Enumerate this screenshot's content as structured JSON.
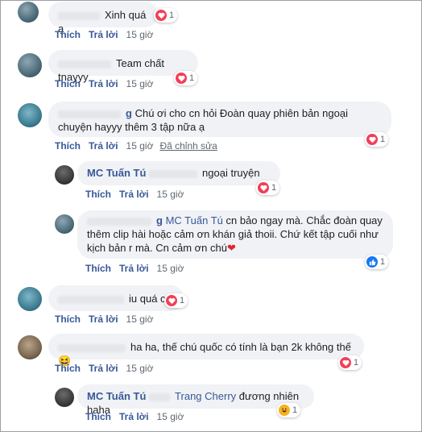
{
  "comments": [
    {
      "text": "Xinh quá ạ",
      "reacts": "1",
      "actions": {
        "like": "Thích",
        "reply": "Trả lời",
        "time": "15 giờ"
      }
    },
    {
      "text": "Team chất tnayyy",
      "reacts": "1",
      "actions": {
        "like": "Thích",
        "reply": "Trả lời",
        "time": "15 giờ"
      }
    },
    {
      "name_suffix": "g",
      "text": "Chú ơi cho cn hỏi Đoàn quay phiên bản ngoại chuyện hayyy thêm 3 tập nữa ạ",
      "reacts": "1",
      "actions": {
        "like": "Thích",
        "reply": "Trả lời",
        "time": "15 giờ",
        "edited": "Đã chỉnh sửa"
      }
    },
    {
      "name": "MC Tuấn Tú",
      "text": "ngoại truyện",
      "reacts": "1",
      "actions": {
        "like": "Thích",
        "reply": "Trả lời",
        "time": "15 giờ"
      }
    },
    {
      "name_suffix": "g",
      "tag": "MC Tuấn Tú",
      "text": "cn bảo ngay mà. Chắc đoàn quay thêm clip hài hoặc cảm ơn khán giả thoii. Chứ kết tập cuối như kịch bản r mà. Cn cảm ơn chú",
      "heart": "❤",
      "reacts": "1",
      "actions": {
        "like": "Thích",
        "reply": "Trả lời",
        "time": "15 giờ"
      }
    },
    {
      "text": "iu quá cơ",
      "reacts": "1",
      "actions": {
        "like": "Thích",
        "reply": "Trả lời",
        "time": "15 giờ"
      }
    },
    {
      "text": "ha ha, thế chú quốc có tính là bạn 2k không thế",
      "emoji": "😆",
      "reacts": "1",
      "actions": {
        "like": "Thích",
        "reply": "Trả lời",
        "time": "15 giờ"
      }
    },
    {
      "name": "MC Tuấn Tú",
      "tag": "Trang Cherry",
      "text": "đương nhiên haha",
      "reacts": "1",
      "actions": {
        "like": "Thích",
        "reply": "Trả lời",
        "time": "15 giờ"
      }
    }
  ],
  "icons": {
    "heart": "heart-icon",
    "like": "like-icon",
    "haha": "haha-icon"
  },
  "colors": {
    "link": "#385898",
    "bubble": "#f0f2f5",
    "heart": "#f33e58",
    "like": "#1877f2",
    "haha": "#f7b125"
  }
}
